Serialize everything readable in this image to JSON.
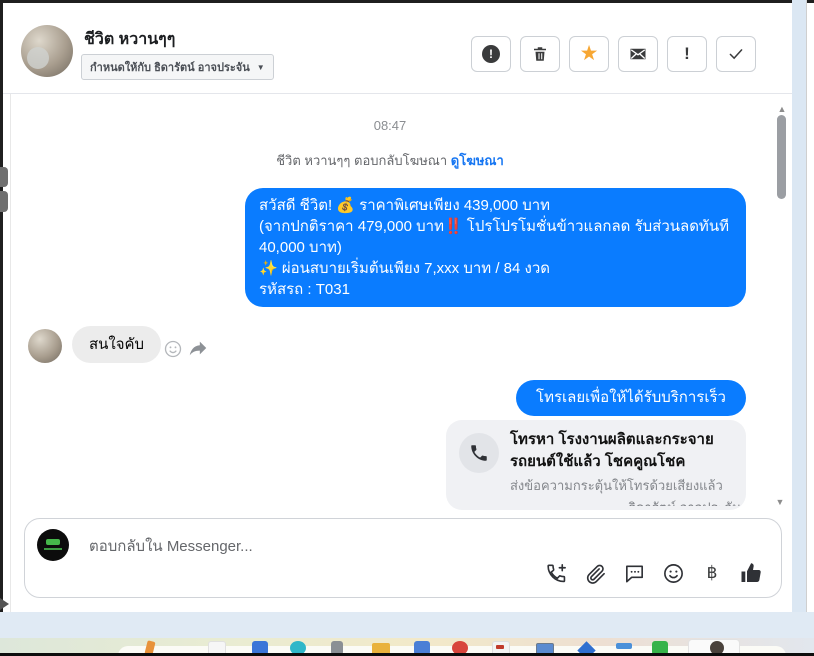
{
  "colors": {
    "accent_blue": "#0a7cff",
    "link_blue": "#1877f2",
    "star_orange": "#f7a733"
  },
  "header": {
    "contact_name": "ชีวิต หวานๆๆ",
    "assign_label": "กำหนดให้กับ ธิดารัตน์ อาจประจัน",
    "toolbar_icons": [
      "report-icon",
      "delete-icon",
      "star-icon",
      "mark-unread-icon",
      "important-icon",
      "done-icon"
    ]
  },
  "conversation": {
    "timestamp": "08:47",
    "ad_context": {
      "text": "ชีวิต หวานๆๆ ตอบกลับโฆษณา ",
      "link_label": "ดูโฆษณา"
    },
    "greeting": {
      "lines": [
        "สวัสดี ชีวิต! 💰 ราคาพิเศษเพียง 439,000 บาท",
        "(จากปกติราคา 479,000 บาท‼️ โปรโปรโมชั่นข้าวแลกลด รับส่วนลดทันที",
        "40,000 บาท)",
        "✨ ผ่อนสบายเริ่มต้นเพียง 7,xxx บาท / 84 งวด",
        "รหัสรถ : T031"
      ]
    },
    "customer_message": {
      "text": "สนใจคับ"
    },
    "cta_message": {
      "text": "โทรเลยเพื่อให้ได้รับบริการเร็วขึ้น"
    },
    "call_card": {
      "title_line1": "โทรหา โรงงานผลิตและกระจาย",
      "title_line2": "รถยนต์ใช้แล้ว โชคคูณโชค",
      "status": "ส่งข้อความกระตุ้นให้โทรด้วยเสียงแล้ว"
    },
    "clipped_label": "ธิดารัตน์ อาจประจัน"
  },
  "composer": {
    "placeholder": "ตอบกลับใน Messenger...",
    "baht_label": "฿",
    "icons": [
      "add-call-icon",
      "attach-icon",
      "saved-replies-icon",
      "emoji-icon",
      "payment-icon",
      "like-icon"
    ]
  },
  "taskbar": {
    "dock_icons": [
      "pencil",
      "file-tile",
      "blue-app",
      "teal-app",
      "gray-app",
      "folder",
      "blue-tool",
      "red-app",
      "media-tile",
      "monitor",
      "blue-diamond",
      "menu-dots",
      "green-app",
      "profile-tile"
    ]
  }
}
